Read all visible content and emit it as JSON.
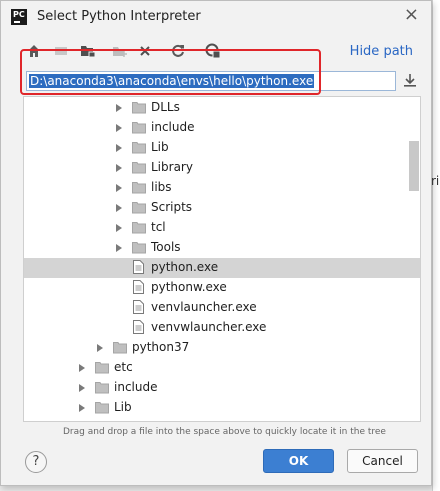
{
  "window": {
    "title": "Select Python Interpreter",
    "app_icon_text": "PC"
  },
  "toolbar": {
    "icons": [
      "home-icon",
      "desktop-icon",
      "project-folder-icon",
      "new-folder-icon",
      "delete-icon",
      "refresh-icon",
      "show-hidden-icon"
    ],
    "hide_path_label": "Hide path"
  },
  "path": {
    "value": "D:\\anaconda3\\anaconda\\envs\\hello\\python.exe"
  },
  "tree": {
    "rows": [
      {
        "label": "DLLs",
        "type": "folder",
        "depth": 2,
        "expandable": true,
        "selected": false
      },
      {
        "label": "include",
        "type": "folder",
        "depth": 2,
        "expandable": true,
        "selected": false
      },
      {
        "label": "Lib",
        "type": "folder",
        "depth": 2,
        "expandable": true,
        "selected": false
      },
      {
        "label": "Library",
        "type": "folder",
        "depth": 2,
        "expandable": true,
        "selected": false
      },
      {
        "label": "libs",
        "type": "folder",
        "depth": 2,
        "expandable": true,
        "selected": false
      },
      {
        "label": "Scripts",
        "type": "folder",
        "depth": 2,
        "expandable": true,
        "selected": false
      },
      {
        "label": "tcl",
        "type": "folder",
        "depth": 2,
        "expandable": true,
        "selected": false
      },
      {
        "label": "Tools",
        "type": "folder",
        "depth": 2,
        "expandable": true,
        "selected": false
      },
      {
        "label": "python.exe",
        "type": "file",
        "depth": 2,
        "expandable": false,
        "selected": true
      },
      {
        "label": "pythonw.exe",
        "type": "file",
        "depth": 2,
        "expandable": false,
        "selected": false
      },
      {
        "label": "venvlauncher.exe",
        "type": "file",
        "depth": 2,
        "expandable": false,
        "selected": false
      },
      {
        "label": "venvwlauncher.exe",
        "type": "file",
        "depth": 2,
        "expandable": false,
        "selected": false
      },
      {
        "label": "python37",
        "type": "folder",
        "depth": 1,
        "expandable": true,
        "selected": false
      },
      {
        "label": "etc",
        "type": "folder",
        "depth": 0,
        "expandable": true,
        "selected": false
      },
      {
        "label": "include",
        "type": "folder",
        "depth": 0,
        "expandable": true,
        "selected": false
      },
      {
        "label": "Lib",
        "type": "folder",
        "depth": 0,
        "expandable": true,
        "selected": false
      }
    ]
  },
  "hint": "Drag and drop a file into the space above to quickly locate it in the tree",
  "buttons": {
    "help": "?",
    "ok": "OK",
    "cancel": "Cancel"
  },
  "background": {
    "partial_text": "ri"
  },
  "colors": {
    "accent": "#3c7fd2",
    "link": "#2a67c4",
    "selection": "#d4d4d4",
    "annotation": "#e0262a"
  }
}
